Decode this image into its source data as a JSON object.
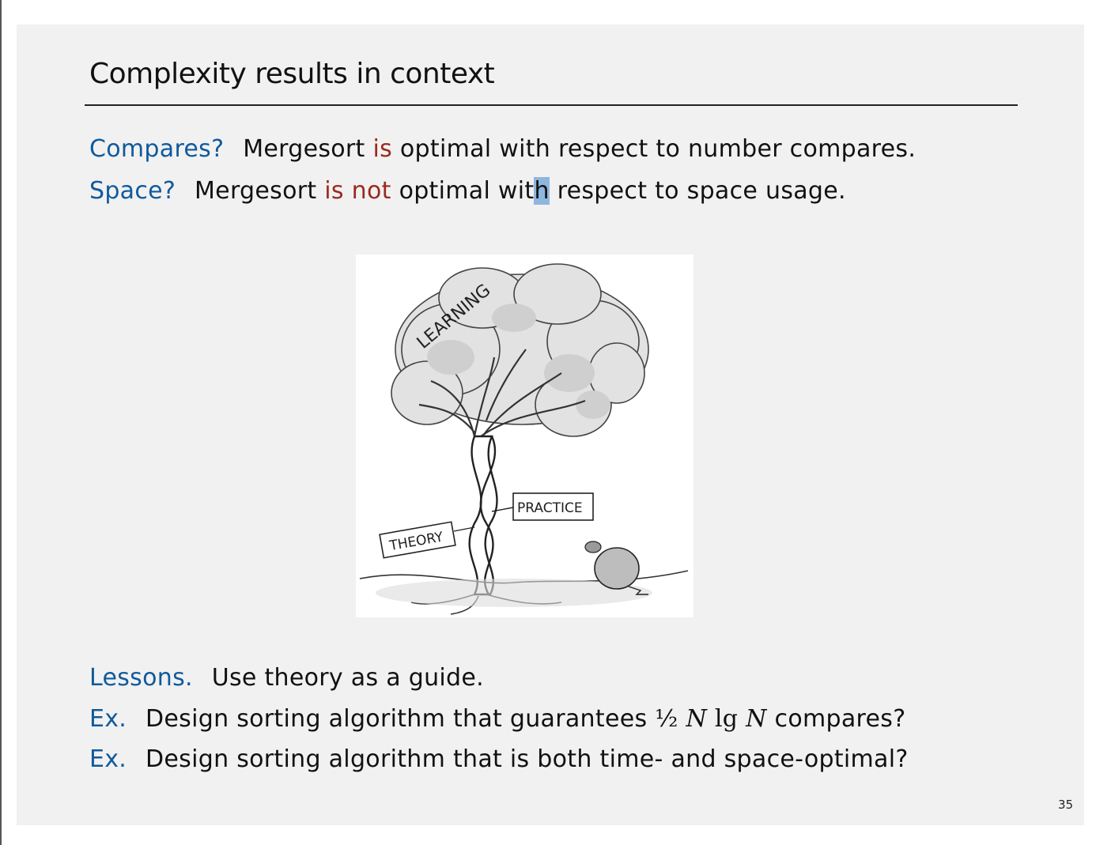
{
  "slide": {
    "title": "Complexity results in context",
    "page_number": "35"
  },
  "compares": {
    "label": "Compares?",
    "pre": "Mergesort",
    "is": "is",
    "post": "optimal with respect to number compares."
  },
  "space": {
    "label": "Space?",
    "pre": "Mergesort",
    "isnot": "is not",
    "post_a": "optimal wit",
    "post_h": "h",
    "post_b": " respect to space usage."
  },
  "figure": {
    "canopy_word": "LEARNING",
    "left_sign": "THEORY",
    "right_sign": "PRACTICE"
  },
  "lessons": {
    "label": "Lessons.",
    "text": "Use theory as a guide."
  },
  "ex1": {
    "label": "Ex.",
    "pre": "Design sorting algorithm that guarantees",
    "half": "½",
    "n1": "N",
    "lg": "lg",
    "n2": "N",
    "post": "compares?"
  },
  "ex2": {
    "label": "Ex.",
    "text": "Design sorting algorithm that is both time- and space-optimal?"
  },
  "colors": {
    "label_blue": "#0f5a9c",
    "emphasis_red": "#9a2a1f",
    "highlight": "#8fb6de"
  }
}
